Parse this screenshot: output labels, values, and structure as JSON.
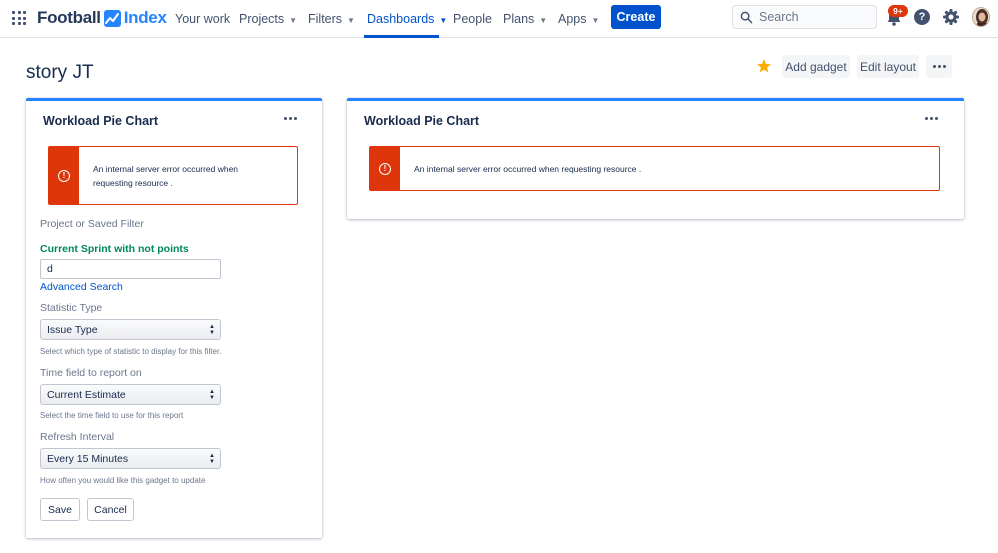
{
  "app": {
    "brand_word1": "Football",
    "brand_word2": "Index"
  },
  "nav": {
    "items": [
      {
        "label": "Your work",
        "dropdown": false
      },
      {
        "label": "Projects",
        "dropdown": true
      },
      {
        "label": "Filters",
        "dropdown": true
      },
      {
        "label": "Dashboards",
        "dropdown": true,
        "active": true
      },
      {
        "label": "People",
        "dropdown": false
      },
      {
        "label": "Plans",
        "dropdown": true
      },
      {
        "label": "Apps",
        "dropdown": true
      }
    ],
    "create_label": "Create",
    "search_placeholder": "Search",
    "notification_badge": "9+",
    "help_glyph": "?"
  },
  "page": {
    "title": "story JT",
    "add_gadget_label": "Add gadget",
    "edit_layout_label": "Edit layout",
    "starred": true
  },
  "gadgets": [
    {
      "title": "Workload Pie Chart",
      "error": "An internal server error occurred when requesting resource .",
      "config": {
        "project_label": "Project or Saved Filter",
        "filter_name": "Current Sprint with not points",
        "filter_input_value": "d",
        "advanced_search_label": "Advanced Search",
        "statistic_label": "Statistic Type",
        "statistic_value": "Issue Type",
        "statistic_help": "Select which type of statistic to display for this filter.",
        "time_field_label": "Time field to report on",
        "time_field_value": "Current Estimate",
        "time_field_help": "Select the time field to use for this report",
        "refresh_label": "Refresh Interval",
        "refresh_value": "Every 15 Minutes",
        "refresh_help": "How often you would like this gadget to update",
        "save_label": "Save",
        "cancel_label": "Cancel"
      }
    },
    {
      "title": "Workload Pie Chart",
      "error": "An internal server error occurred when requesting resource ."
    }
  ],
  "colors": {
    "primary": "#0052cc",
    "gadget_accent": "#2684ff",
    "error": "#de350b",
    "success_text": "#00875a",
    "star": "#ffab00"
  }
}
